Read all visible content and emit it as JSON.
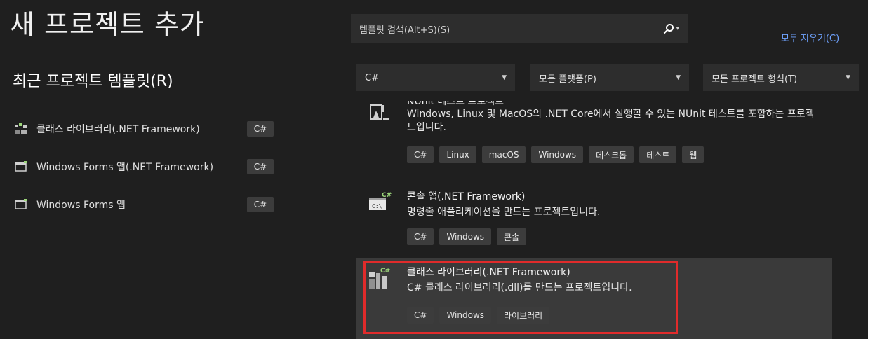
{
  "window": {
    "title": "새 프로젝트 추가"
  },
  "recent": {
    "heading": "최근 프로젝트 템플릿(R)",
    "items": [
      {
        "label": "클래스 라이브러리(.NET Framework)",
        "lang": "C#",
        "icon": "class-library-icon"
      },
      {
        "label": "Windows Forms 앱(.NET Framework)",
        "lang": "C#",
        "icon": "windows-forms-icon"
      },
      {
        "label": "Windows Forms 앱",
        "lang": "C#",
        "icon": "windows-forms-icon"
      }
    ]
  },
  "search": {
    "placeholder": "템플릿 검색(Alt+S)(S)",
    "clear_all": "모두 지우기(C)"
  },
  "filters": {
    "language": "C#",
    "platform": "모든 플랫폼(P)",
    "project_type": "모든 프로젝트 형식(T)"
  },
  "templates": [
    {
      "name": "NUnit 테스트 프로젝트",
      "description": "Windows, Linux 및 MacOS의 .NET Core에서 실행할 수 있는 NUnit 테스트를 포함하는 프로젝트입니다.",
      "tags": [
        "C#",
        "Linux",
        "macOS",
        "Windows",
        "데스크톱",
        "테스트",
        "웹"
      ]
    },
    {
      "name": "콘솔 앱(.NET Framework)",
      "description": "명령줄 애플리케이션을 만드는 프로젝트입니다.",
      "tags": [
        "C#",
        "Windows",
        "콘솔"
      ]
    },
    {
      "name": "클래스 라이브러리(.NET Framework)",
      "description": "C# 클래스 라이브러리(.dll)를 만드는 프로젝트입니다.",
      "tags": [
        "C#",
        "Windows",
        "라이브러리"
      ],
      "selected": true
    }
  ],
  "colors": {
    "background": "#1f1f1f",
    "panel": "#2d2d2d",
    "link": "#6fa3ff",
    "highlight": "#e02b2b"
  }
}
